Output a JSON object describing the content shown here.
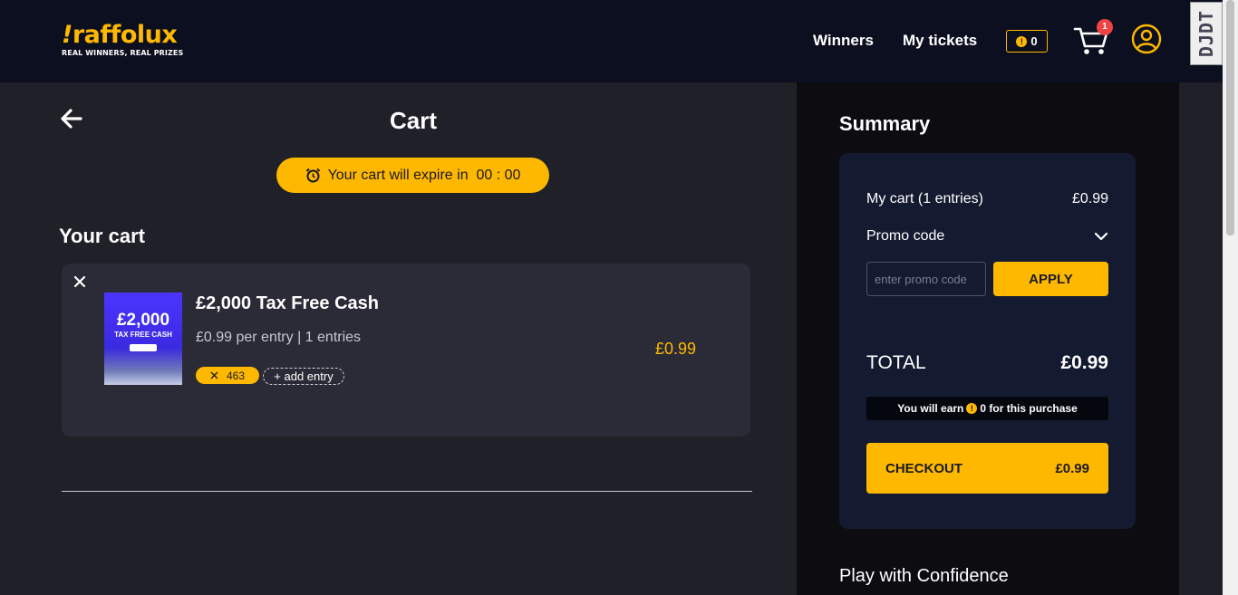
{
  "header": {
    "logo_word": "raffolux",
    "logo_tagline": "REAL WINNERS, REAL PRIZES",
    "nav": [
      "Winners",
      "My tickets"
    ],
    "points": "0",
    "cart_count": "1",
    "devtools_label": "DJDT"
  },
  "page": {
    "title": "Cart",
    "timer_text": "Your cart will expire in  00 : 00",
    "section_title": "Your cart"
  },
  "cart_items": [
    {
      "name": "£2,000 Tax Free Cash",
      "meta": "£0.99 per entry | 1 entries",
      "ticket_number": "463",
      "add_entry": "+ add entry",
      "price": "£0.99",
      "image_amount": "£2,000",
      "image_sub": "TAX FREE CASH"
    }
  ],
  "summary": {
    "title": "Summary",
    "my_cart_label": "My cart (1 entries)",
    "my_cart_value": "£0.99",
    "promo_label": "Promo code",
    "promo_placeholder": "enter promo code",
    "apply_label": "APPLY",
    "total_label": "TOTAL",
    "total_value": "£0.99",
    "earn_prefix": "You will earn",
    "earn_suffix": "0 for this purchase",
    "checkout_label": "CHECKOUT",
    "checkout_value": "£0.99"
  },
  "confidence_title": "Play with Confidence",
  "colors": {
    "accent": "#ffb800",
    "header_bg": "#0c0f1f",
    "page_bg": "#202029",
    "card_bg": "#2b2b37",
    "summary_card_bg": "#141a30",
    "badge_red": "#ef4444"
  }
}
